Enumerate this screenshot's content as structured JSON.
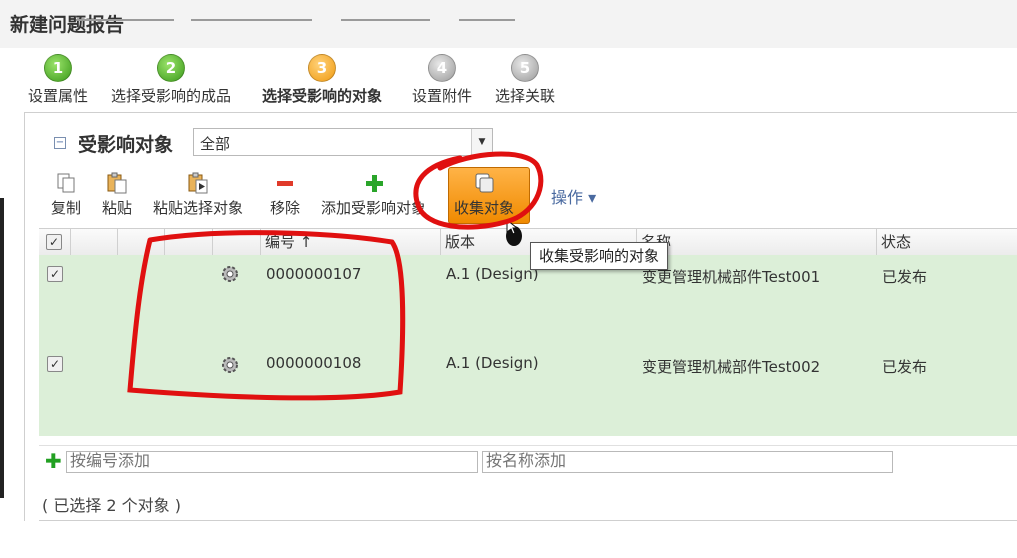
{
  "window": {
    "title": "新建问题报告"
  },
  "wizard": {
    "steps": [
      {
        "num": "1",
        "label": "设置属性",
        "state": "done"
      },
      {
        "num": "2",
        "label": "选择受影响的成品",
        "state": "done"
      },
      {
        "num": "3",
        "label": "选择受影响的对象",
        "state": "current"
      },
      {
        "num": "4",
        "label": "设置附件",
        "state": "todo"
      },
      {
        "num": "5",
        "label": "选择关联",
        "state": "todo"
      }
    ]
  },
  "panel": {
    "collapse": "−",
    "title": "受影响对象",
    "filter_value": "全部"
  },
  "toolbar": {
    "copy": "复制",
    "paste": "粘贴",
    "paste_selection": "粘贴选择对象",
    "remove": "移除",
    "add_affected": "添加受影响对象",
    "collect": "收集对象",
    "actions": "操作 ▾"
  },
  "table": {
    "headers": {
      "number": "编号 ↑",
      "version": "版本",
      "name": "名称",
      "status": "状态"
    },
    "rows": [
      {
        "number": "0000000107",
        "version": "A.1 (Design)",
        "name": "变更管理机械部件Test001",
        "status": "已发布"
      },
      {
        "number": "0000000108",
        "version": "A.1 (Design)",
        "name": "变更管理机械部件Test002",
        "status": "已发布"
      }
    ]
  },
  "add": {
    "by_number_placeholder": "按编号添加",
    "by_name_placeholder": "按名称添加"
  },
  "selection_status": "( 已选择 2 个对象 )",
  "tooltip": "收集受影响的对象",
  "colors": {
    "row_selected": "#dcefd8",
    "accent_orange": "#f08a00",
    "annotation_red": "#e01010"
  }
}
